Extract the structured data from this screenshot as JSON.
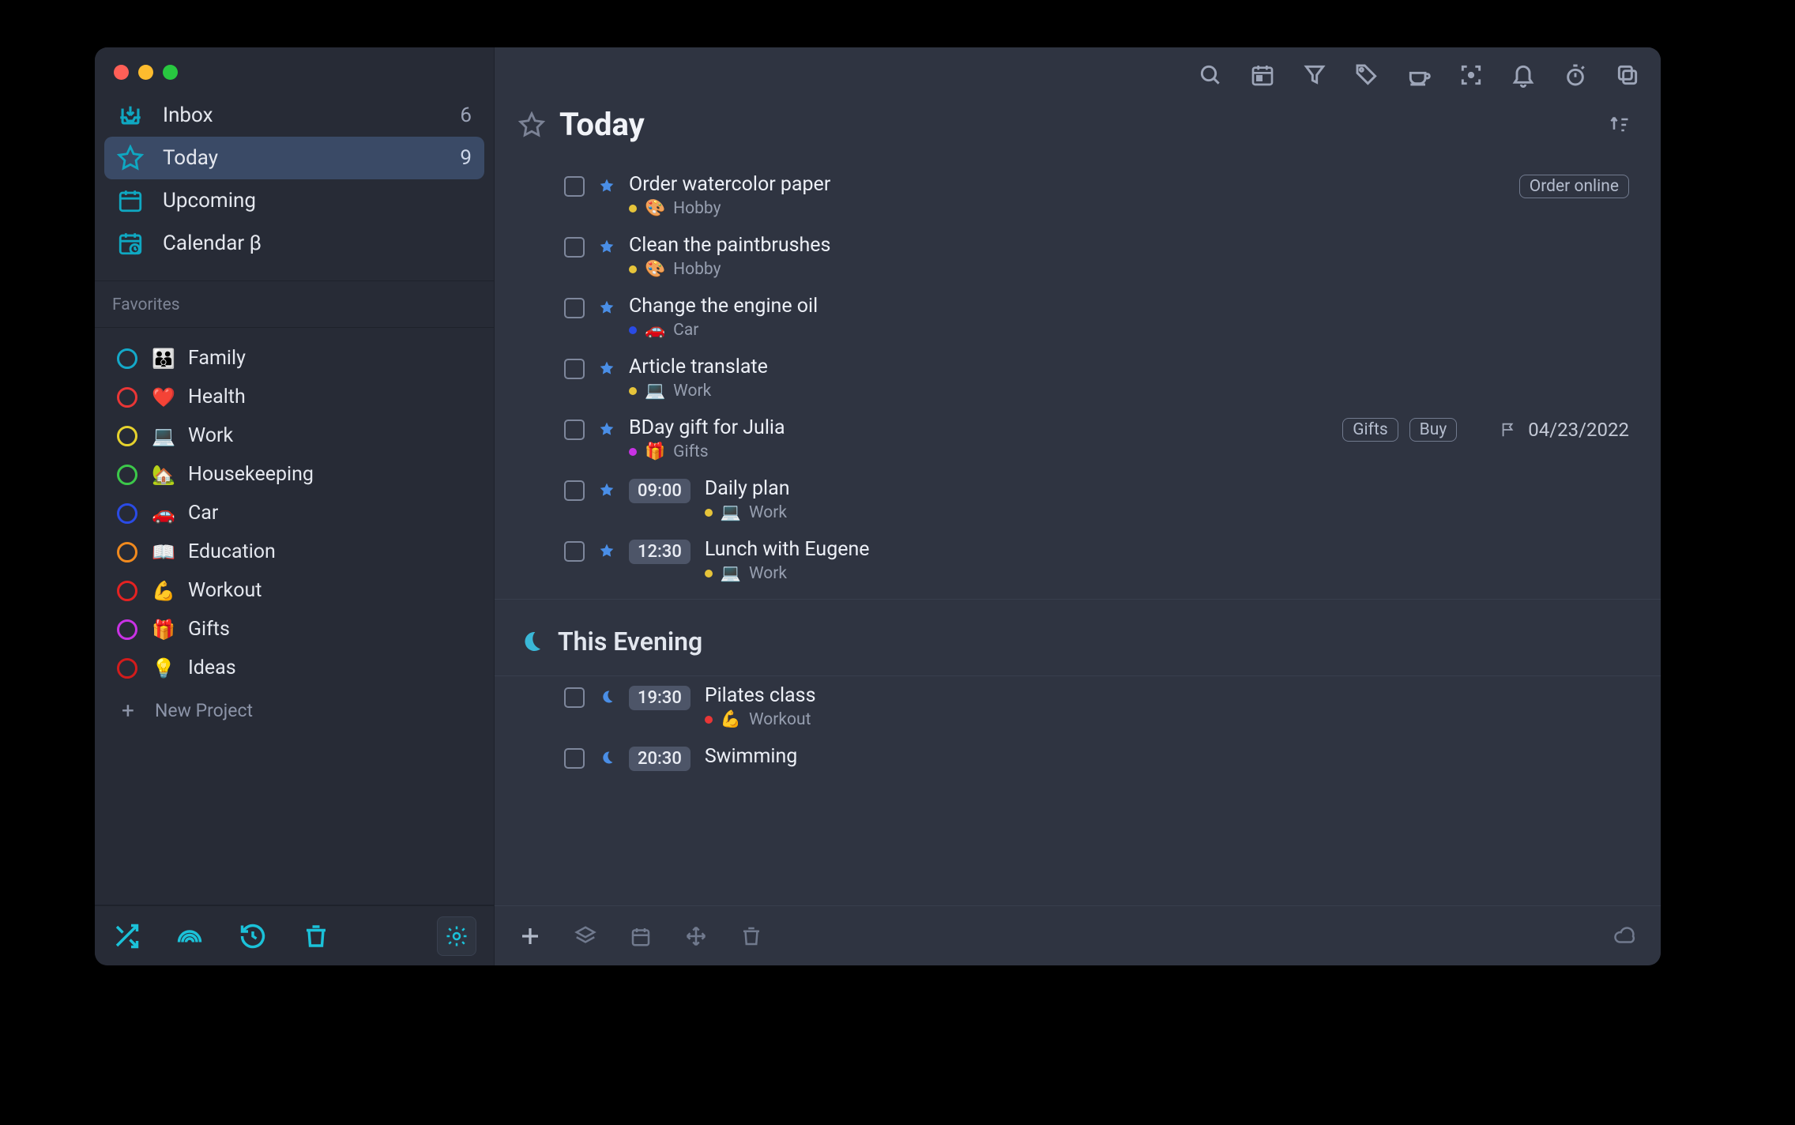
{
  "nav": {
    "inbox": {
      "label": "Inbox",
      "count": "6"
    },
    "today": {
      "label": "Today",
      "count": "9"
    },
    "upcoming": {
      "label": "Upcoming"
    },
    "calendar": {
      "label": "Calendar β"
    }
  },
  "favorites_label": "Favorites",
  "projects": [
    {
      "name": "Family",
      "emoji": "👪",
      "color": "#14a9c9"
    },
    {
      "name": "Health",
      "emoji": "❤️",
      "color": "#e93636"
    },
    {
      "name": "Work",
      "emoji": "💻",
      "color": "#e6d22d"
    },
    {
      "name": "Housekeeping",
      "emoji": "🏡",
      "color": "#3cc84a"
    },
    {
      "name": "Car",
      "emoji": "🚗",
      "color": "#2a4be5"
    },
    {
      "name": "Education",
      "emoji": "📖",
      "color": "#f18a1e"
    },
    {
      "name": "Workout",
      "emoji": "💪",
      "color": "#e42222"
    },
    {
      "name": "Gifts",
      "emoji": "🎁",
      "color": "#c932e5"
    },
    {
      "name": "Ideas",
      "emoji": "💡",
      "color": "#d21c1c"
    }
  ],
  "new_project_label": "New Project",
  "header": {
    "title": "Today"
  },
  "section_evening": {
    "title": "This Evening"
  },
  "tasks_today": [
    {
      "title": "Order watercolor paper",
      "project": "Hobby",
      "proj_emoji": "🎨",
      "dot": "#e6c43a",
      "star": true,
      "pills": [
        "Order online"
      ]
    },
    {
      "title": "Clean the paintbrushes",
      "project": "Hobby",
      "proj_emoji": "🎨",
      "dot": "#e6c43a",
      "star": true
    },
    {
      "title": "Change the engine oil",
      "project": "Car",
      "proj_emoji": "🚗",
      "dot": "#2a4be5",
      "star": true
    },
    {
      "title": "Article translate",
      "project": "Work",
      "proj_emoji": "💻",
      "dot": "#e6c43a",
      "star": true
    },
    {
      "title": "BDay gift for Julia",
      "project": "Gifts",
      "proj_emoji": "🎁",
      "dot": "#c932e5",
      "star": true,
      "pills": [
        "Gifts",
        "Buy"
      ],
      "flag": true,
      "date": "04/23/2022"
    },
    {
      "title": "Daily plan",
      "project": "Work",
      "proj_emoji": "💻",
      "dot": "#e6c43a",
      "star": true,
      "time": "09:00"
    },
    {
      "title": "Lunch with Eugene",
      "project": "Work",
      "proj_emoji": "💻",
      "dot": "#e6c43a",
      "star": true,
      "time": "12:30"
    }
  ],
  "tasks_evening": [
    {
      "title": "Pilates class",
      "project": "Workout",
      "proj_emoji": "💪",
      "dot": "#e93636",
      "moon": true,
      "time": "19:30"
    },
    {
      "title": "Swimming",
      "moon": true,
      "time": "20:30"
    }
  ]
}
